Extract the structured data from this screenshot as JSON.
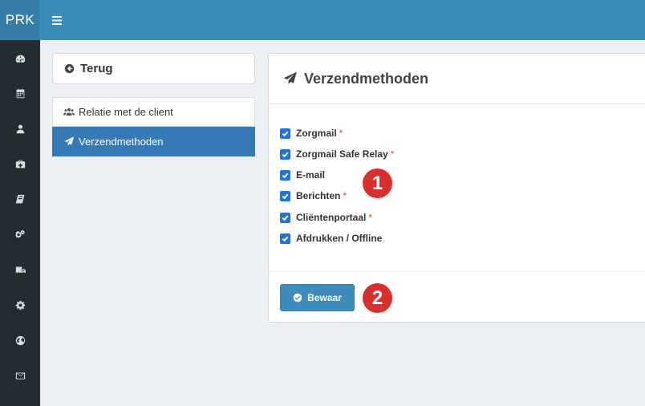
{
  "app": {
    "logo": "PRK"
  },
  "rail": {
    "icons": [
      "dashboard-icon",
      "calendar-icon",
      "user-icon",
      "medkit-icon",
      "book-icon",
      "cogs-icon",
      "truck-icon",
      "gear-icon",
      "globe-icon",
      "envelope-icon"
    ]
  },
  "back": {
    "label": "Terug"
  },
  "nav": {
    "items": [
      {
        "label": "Relatie met de client",
        "icon": "users-icon",
        "active": false
      },
      {
        "label": "Verzendmethoden",
        "icon": "paper-plane-icon",
        "active": true
      }
    ]
  },
  "panel": {
    "title": "Verzendmethoden",
    "options": [
      {
        "label": "Zorgmail",
        "required": "*",
        "checked": true
      },
      {
        "label": "Zorgmail Safe Relay",
        "required": "*",
        "checked": true
      },
      {
        "label": "E-mail",
        "required": "",
        "checked": true
      },
      {
        "label": "Berichten",
        "required": "*",
        "checked": true
      },
      {
        "label": "Cliëntenportaal",
        "required": "*",
        "checked": true
      },
      {
        "label": "Afdrukken / Offline",
        "required": "",
        "checked": true
      }
    ],
    "save_label": "Bewaar"
  },
  "callouts": [
    "1",
    "2"
  ],
  "colors": {
    "topbar": "#3c8dbc",
    "rail": "#222d32",
    "active_nav": "#337ab7",
    "badge": "#d9302c"
  }
}
